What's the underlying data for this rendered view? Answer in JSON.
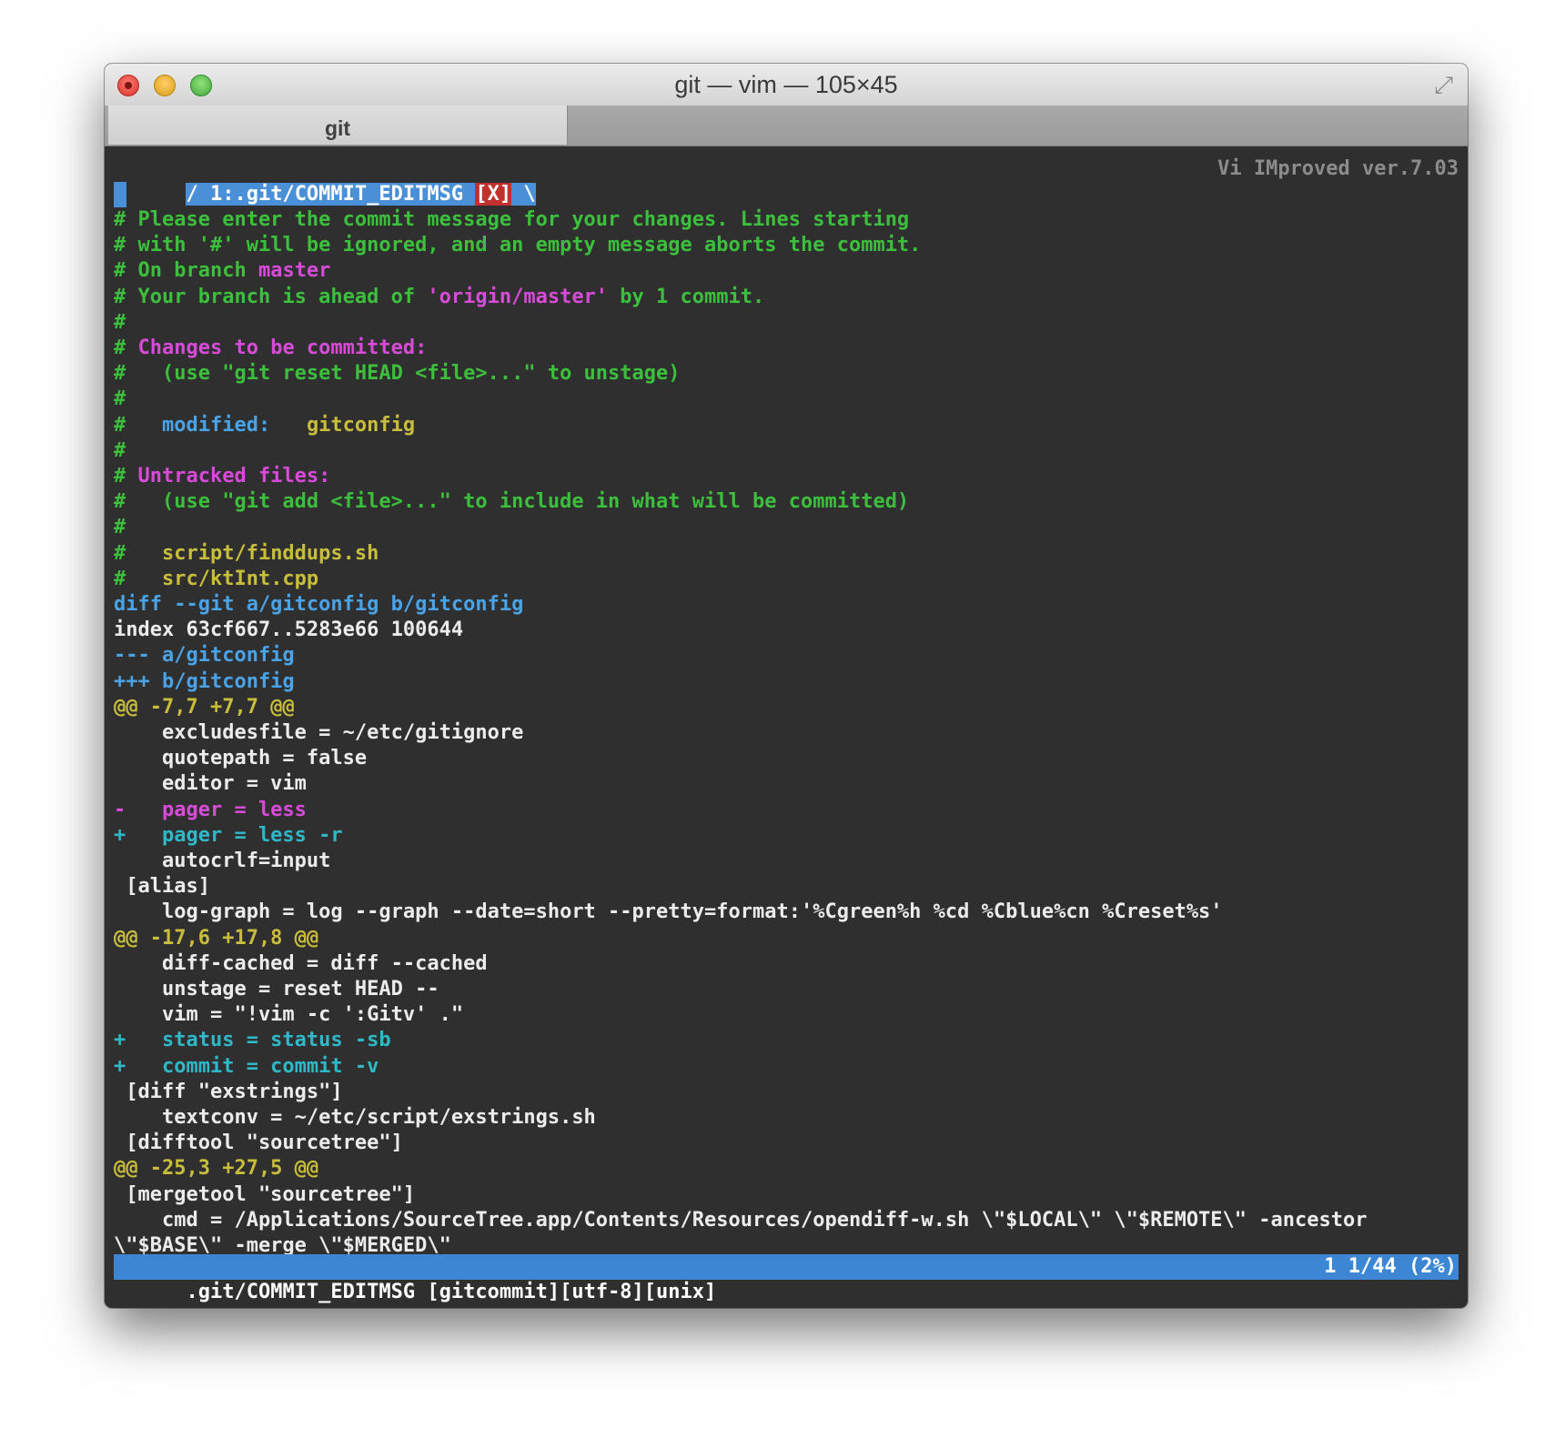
{
  "window": {
    "title": "git — vim — 105×45",
    "tab_label": "git"
  },
  "vim": {
    "tabline": {
      "active_tab": "/ 1:.git/COMMIT_EDITMSG ",
      "modified_flag": "[X]",
      "tail": " \\",
      "right_label": "Vi IMproved ver.7.03"
    },
    "lines": [
      [
        {
          "t": "# Please enter the commit message for your changes. Lines starting",
          "c": "green"
        }
      ],
      [
        {
          "t": "# with '#' will be ignored, and an empty message aborts the commit.",
          "c": "green"
        }
      ],
      [
        {
          "t": "# On branch ",
          "c": "green"
        },
        {
          "t": "master",
          "c": "pink"
        }
      ],
      [
        {
          "t": "# Your branch is ahead of ",
          "c": "green"
        },
        {
          "t": "'origin/master'",
          "c": "pink"
        },
        {
          "t": " by 1 commit.",
          "c": "green"
        }
      ],
      [
        {
          "t": "#",
          "c": "green"
        }
      ],
      [
        {
          "t": "# ",
          "c": "green"
        },
        {
          "t": "Changes to be committed:",
          "c": "pink"
        }
      ],
      [
        {
          "t": "#   (use \"git reset HEAD <file>...\" to unstage)",
          "c": "green"
        }
      ],
      [
        {
          "t": "#",
          "c": "green"
        }
      ],
      [
        {
          "t": "#   ",
          "c": "green"
        },
        {
          "t": "modified:",
          "c": "blue"
        },
        {
          "t": "   gitconfig",
          "c": "yellow"
        }
      ],
      [
        {
          "t": "#",
          "c": "green"
        }
      ],
      [
        {
          "t": "# ",
          "c": "green"
        },
        {
          "t": "Untracked files:",
          "c": "pink"
        }
      ],
      [
        {
          "t": "#   (use \"git add <file>...\" to include in what will be committed)",
          "c": "green"
        }
      ],
      [
        {
          "t": "#",
          "c": "green"
        }
      ],
      [
        {
          "t": "#   ",
          "c": "green"
        },
        {
          "t": "script/finddups.sh",
          "c": "yellow"
        }
      ],
      [
        {
          "t": "#   ",
          "c": "green"
        },
        {
          "t": "src/ktInt.cpp",
          "c": "yellow"
        }
      ],
      [
        {
          "t": "diff --git a/gitconfig b/gitconfig",
          "c": "blue"
        }
      ],
      [
        {
          "t": "index 63cf667..5283e66 100644",
          "c": "white"
        }
      ],
      [
        {
          "t": "--- a/gitconfig",
          "c": "blue"
        }
      ],
      [
        {
          "t": "+++ b/gitconfig",
          "c": "blue"
        }
      ],
      [
        {
          "t": "@@ -7,7 +7,7 @@",
          "c": "yellow"
        }
      ],
      [
        {
          "t": "    excludesfile = ~/etc/gitignore",
          "c": "white"
        }
      ],
      [
        {
          "t": "    quotepath = false",
          "c": "white"
        }
      ],
      [
        {
          "t": "    editor = vim",
          "c": "white"
        }
      ],
      [
        {
          "t": "-   pager = less",
          "c": "pink"
        }
      ],
      [
        {
          "t": "+   pager = less -r",
          "c": "cyan"
        }
      ],
      [
        {
          "t": "    autocrlf=input",
          "c": "white"
        }
      ],
      [
        {
          "t": " [alias]",
          "c": "white"
        }
      ],
      [
        {
          "t": "    log-graph = log --graph --date=short --pretty=format:'%Cgreen%h %cd %Cblue%cn %Creset%s'",
          "c": "white"
        }
      ],
      [
        {
          "t": "@@ -17,6 +17,8 @@",
          "c": "yellow"
        }
      ],
      [
        {
          "t": "    diff-cached = diff --cached",
          "c": "white"
        }
      ],
      [
        {
          "t": "    unstage = reset HEAD --",
          "c": "white"
        }
      ],
      [
        {
          "t": "    vim = \"!vim -c ':Gitv' .\"",
          "c": "white"
        }
      ],
      [
        {
          "t": "+   status = status -sb",
          "c": "cyan"
        }
      ],
      [
        {
          "t": "+   commit = commit -v",
          "c": "cyan"
        }
      ],
      [
        {
          "t": " [diff \"exstrings\"]",
          "c": "white"
        }
      ],
      [
        {
          "t": "    textconv = ~/etc/script/exstrings.sh",
          "c": "white"
        }
      ],
      [
        {
          "t": " [difftool \"sourcetree\"]",
          "c": "white"
        }
      ],
      [
        {
          "t": "@@ -25,3 +27,5 @@",
          "c": "yellow"
        }
      ],
      [
        {
          "t": " [mergetool \"sourcetree\"]",
          "c": "white"
        }
      ],
      [
        {
          "t": "    cmd = /Applications/SourceTree.app/Contents/Resources/opendiff-w.sh \\\"$LOCAL\\\" \\\"$REMOTE\\\" -ancestor",
          "c": "white"
        }
      ],
      [
        {
          "t": "\\\"$BASE\\\" -merge \\\"$MERGED\\\"",
          "c": "white"
        }
      ]
    ],
    "statusline": {
      "left": ".git/COMMIT_EDITMSG [gitcommit][utf-8][unix]",
      "right": "1 1/44 (2%)"
    }
  },
  "colors": {
    "green": "#3cbf3c",
    "pink": "#d84bd8",
    "blue": "#4aa3e6",
    "yellow": "#c9bd3c",
    "white": "#ececec",
    "cyan": "#2fb8c8",
    "statusline_bg": "#3c86d4",
    "terminal_bg": "#2f2f2f"
  }
}
